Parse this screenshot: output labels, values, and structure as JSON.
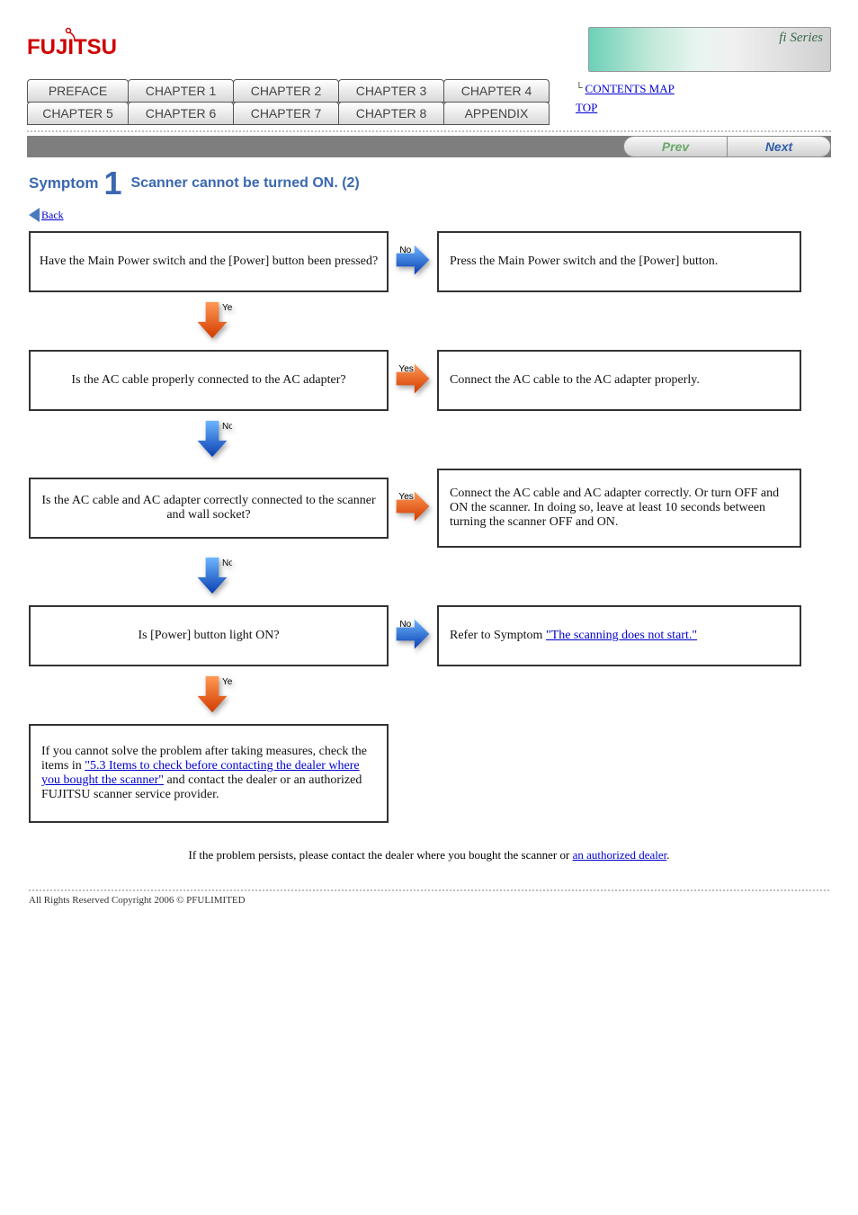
{
  "logo_text": "FUJITSU",
  "banner_text": "fi Series",
  "tabs_row1": [
    "PREFACE",
    "CHAPTER 1",
    "CHAPTER 2",
    "CHAPTER 3",
    "CHAPTER 4"
  ],
  "tabs_row2": [
    "CHAPTER 5",
    "CHAPTER 6",
    "CHAPTER 7",
    "CHAPTER 8",
    "APPENDIX"
  ],
  "right_links": {
    "contents": "CONTENTS MAP",
    "top": "TOP"
  },
  "pager": {
    "prev": "Prev",
    "next": "Next"
  },
  "section": {
    "title_prefix": "Symptom",
    "num": "1",
    "title": "Scanner cannot be turned ON. (2)",
    "back": "Back"
  },
  "boxes": {
    "q1": "Have the Main Power switch and the [Power] button been pressed?",
    "a1": "Press the Main Power switch and the [Power] button.",
    "q2": "Is the AC cable properly connected to the AC adapter?",
    "a2": "Connect the AC cable to the AC adapter properly.",
    "q3": "Is the AC cable and AC adapter correctly connected to the scanner and wall socket?",
    "a3": "Connect the AC cable and AC adapter correctly. Or turn OFF and ON the scanner. In doing so, leave at least 10 seconds between turning the scanner OFF and ON.",
    "q4": "Is [Power] button light ON?",
    "a4_prefix": "Refer to Symptom ",
    "a4_link": "\"The scanning does not start.\"",
    "final_prefix": "If you cannot solve the problem after taking measures, check the items in ",
    "final_link": "\"5.3 Items to check before contacting the dealer where you bought the scanner\"",
    "final_suffix": " and contact the dealer or an authorized FUJITSU scanner service provider."
  },
  "legend": {
    "yes": "Yes",
    "no": "No"
  },
  "bottom": {
    "note": "If the problem persists, please contact the dealer where you bought the scanner or ",
    "note_link": "an authorized dealer"
  },
  "copyright": "All Rights Reserved Copyright 2006 © PFULIMITED",
  "colors": {
    "orange_light": "#ff7a2b",
    "orange_dark": "#d23a00",
    "blue_light": "#4aa0ff",
    "blue_dark": "#0a3fb0"
  }
}
